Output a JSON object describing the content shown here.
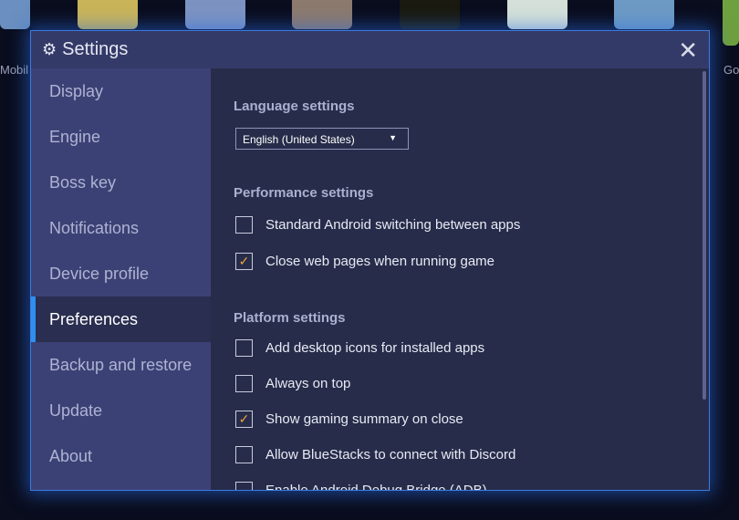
{
  "background": {
    "labels": [
      "Mobil",
      "Go"
    ]
  },
  "dialog": {
    "title": "Settings",
    "title_icon": "gear-icon",
    "close_icon": "close-icon"
  },
  "sidebar": {
    "items": [
      {
        "label": "Display"
      },
      {
        "label": "Engine"
      },
      {
        "label": "Boss key"
      },
      {
        "label": "Notifications"
      },
      {
        "label": "Device profile"
      },
      {
        "label": "Preferences",
        "active": true
      },
      {
        "label": "Backup and restore"
      },
      {
        "label": "Update"
      },
      {
        "label": "About"
      }
    ]
  },
  "main": {
    "language": {
      "heading": "Language settings",
      "selected": "English (United States)"
    },
    "performance": {
      "heading": "Performance settings",
      "options": [
        {
          "label": "Standard Android switching between apps",
          "checked": false
        },
        {
          "label": "Close web pages when running game",
          "checked": true
        }
      ]
    },
    "platform": {
      "heading": "Platform settings",
      "options": [
        {
          "label": "Add desktop icons for installed apps",
          "checked": false
        },
        {
          "label": "Always on top",
          "checked": false
        },
        {
          "label": "Show gaming summary on close",
          "checked": true
        },
        {
          "label": "Allow BlueStacks to connect with Discord",
          "checked": false
        },
        {
          "label": "Enable Android Debug Bridge (ADB)",
          "checked": false
        }
      ]
    }
  },
  "colors": {
    "accent": "#2f8ff0",
    "check": "#e8a23a",
    "sidebar": "#3c4175",
    "content": "#272c4a"
  }
}
